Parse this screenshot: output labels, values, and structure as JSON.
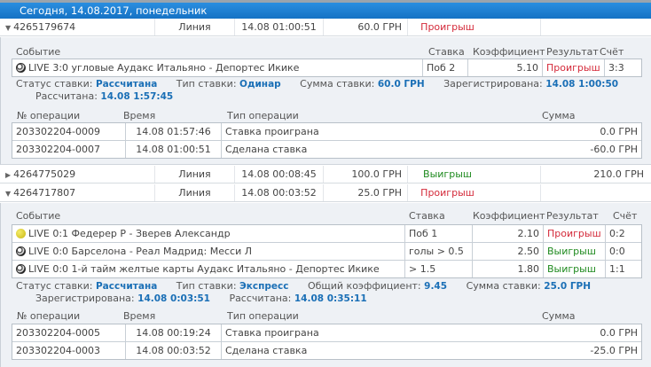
{
  "header": {
    "title": "Сегодня, 14.08.2017, понедельник"
  },
  "labels": {
    "event": "Событие",
    "stake": "Ставка",
    "coef": "Коэффициент",
    "result": "Результат",
    "score": "Счёт",
    "op_no": "№ операции",
    "time": "Время",
    "op_type": "Тип операции",
    "sum": "Сумма",
    "status": "Статус ставки:",
    "bet_type": "Тип ставки:",
    "bet_sum": "Сумма ставки:",
    "registered": "Зарегистрирована:",
    "settled": "Рассчитана:",
    "total_coef": "Общий коэффициент:"
  },
  "bets": [
    {
      "id": "4265179674",
      "line": "Линия",
      "datetime": "14.08  01:00:51",
      "amount": "60.0 ГРН",
      "result": "Проигрыш",
      "win": "",
      "events": [
        {
          "icon": "soccer-ball",
          "name": "LIVE 3:0 угловые Аудакс Итальяно - Депортес Икике",
          "stake": "Поб 2",
          "coef": "5.10",
          "result": "Проигрыш",
          "score": "3:3"
        }
      ],
      "status": "Рассчитана",
      "type": "Одинар",
      "sum": "60.0 ГРН",
      "registered": "14.08 1:00:50",
      "settled": "14.08 1:57:45",
      "ops": [
        {
          "no": "203302204-0009",
          "time": "14.08  01:57:46",
          "type": "Ставка проиграна",
          "sum": "0.0 ГРН"
        },
        {
          "no": "203302204-0007",
          "time": "14.08  01:00:51",
          "type": "Сделана ставка",
          "sum": "-60.0 ГРН"
        }
      ]
    },
    {
      "id": "4264775029",
      "line": "Линия",
      "datetime": "14.08  00:08:45",
      "amount": "100.0 ГРН",
      "result": "Выигрыш",
      "win": "210.0 ГРН"
    },
    {
      "id": "4264717807",
      "line": "Линия",
      "datetime": "14.08  00:03:52",
      "amount": "25.0 ГРН",
      "result": "Проигрыш",
      "win": "",
      "events": [
        {
          "icon": "tennis-ball",
          "name": "LIVE 0:1 Федерер Р - Зверев Александр",
          "stake": "Поб 1",
          "coef": "2.10",
          "result": "Проигрыш",
          "score": "0:2"
        },
        {
          "icon": "soccer-ball",
          "name": "LIVE 0:0 Барселона - Реал Мадрид: Месси Л",
          "stake": "голы > 0.5",
          "coef": "2.50",
          "result": "Выигрыш",
          "score": "0:0"
        },
        {
          "icon": "soccer-ball",
          "name": "LIVE 0:0 1-й тайм желтые карты Аудакс Итальяно - Депортес Икике",
          "stake": "> 1.5",
          "coef": "1.80",
          "result": "Выигрыш",
          "score": "1:1"
        }
      ],
      "status": "Рассчитана",
      "type": "Экспресс",
      "total_coef": "9.45",
      "sum": "25.0 ГРН",
      "registered": "14.08 0:03:51",
      "settled": "14.08 0:35:11",
      "ops": [
        {
          "no": "203302204-0005",
          "time": "14.08  00:19:24",
          "type": "Ставка проиграна",
          "sum": "0.0 ГРН"
        },
        {
          "no": "203302204-0003",
          "time": "14.08  00:03:52",
          "type": "Сделана ставка",
          "sum": "-25.0 ГРН"
        }
      ]
    }
  ]
}
